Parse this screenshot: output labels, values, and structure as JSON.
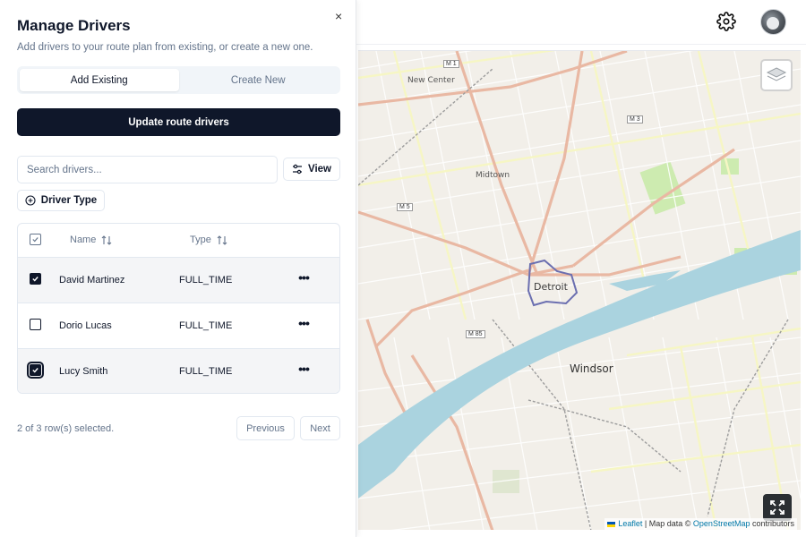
{
  "panel": {
    "title": "Manage Drivers",
    "subtitle": "Add drivers to your route plan from existing, or create a new one.",
    "close_icon": "×",
    "tabs": [
      {
        "label": "Add Existing",
        "active": true
      },
      {
        "label": "Create New",
        "active": false
      }
    ],
    "update_button": "Update route drivers",
    "search_placeholder": "Search drivers...",
    "view_button": "View",
    "driver_type_button": "Driver Type",
    "columns": {
      "name": "Name",
      "type": "Type"
    },
    "rows": [
      {
        "name": "David Martinez",
        "type": "FULL_TIME",
        "checked": true
      },
      {
        "name": "Dorio Lucas",
        "type": "FULL_TIME",
        "checked": false
      },
      {
        "name": "Lucy Smith",
        "type": "FULL_TIME",
        "checked": true
      }
    ],
    "row_actions_icon": "•••",
    "selection_summary": "2 of 3 row(s) selected.",
    "previous_button": "Previous",
    "next_button": "Next"
  },
  "map": {
    "labels": {
      "new_center": "New Center",
      "midtown": "Midtown",
      "detroit": "Detroit",
      "windsor": "Windsor"
    },
    "shields": {
      "m3": "M 3",
      "m5": "M 5",
      "m85": "M 85",
      "m1": "M 1"
    },
    "attribution": {
      "leaflet": "Leaflet",
      "sep": " | Map data © ",
      "osm": "OpenStreetMap",
      "tail": " contributors"
    }
  },
  "colors": {
    "primary": "#0f172a",
    "water": "#aad3df",
    "land": "#f2efe9",
    "major_road": "#f0c9b0",
    "minor_road": "#f6f6c4",
    "park": "#cdebb0"
  },
  "icons": {
    "gear": "gear-icon",
    "avatar": "avatar",
    "layers": "layers-icon",
    "fullscreen": "fullscreen-icon",
    "sort": "sort-icon",
    "sliders": "sliders-icon",
    "plus_circle": "plus-circle-icon"
  }
}
